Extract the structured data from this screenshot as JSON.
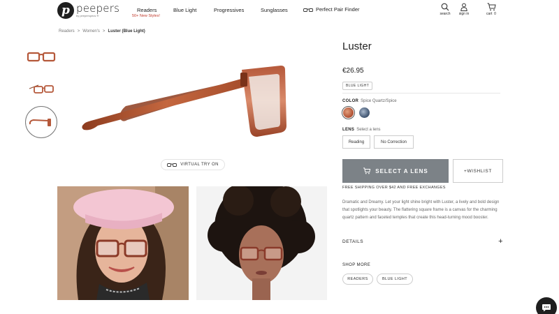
{
  "header": {
    "logo_letter": "p",
    "logo_name": "peepers",
    "logo_sub": "by peeperspecs ®",
    "nav": [
      {
        "label": "Readers",
        "sub": "50+ New Styles!"
      },
      {
        "label": "Blue Light"
      },
      {
        "label": "Progressives"
      },
      {
        "label": "Sunglasses"
      },
      {
        "label": "Perfect Pair Finder",
        "icon": "glasses-icon"
      }
    ],
    "utilities": [
      {
        "label": "search",
        "icon": "search-icon"
      },
      {
        "label": "sign in",
        "icon": "user-icon"
      },
      {
        "label": "cart",
        "icon": "cart-icon",
        "count": "0"
      }
    ]
  },
  "breadcrumb": [
    "Readers",
    "Women's",
    "Luster (Blue Light)"
  ],
  "gallery": {
    "virtual_try_on": "VIRTUAL TRY ON"
  },
  "product": {
    "title": "Luster",
    "price": "€26.95",
    "tag": "BLUE LIGHT",
    "color_label": "COLOR",
    "color_value": "Spice Quartz/Spice",
    "swatches": [
      {
        "name": "Spice Quartz/Spice",
        "color": "#b5583a",
        "selected": true
      },
      {
        "name": "blue",
        "color": "#4a5f7a",
        "selected": false
      }
    ],
    "lens_label": "LENS",
    "lens_value": "Select a lens",
    "lens_options": [
      "Reading",
      "No Correction"
    ],
    "select_lens_button": "SELECT A LENS",
    "wishlist_button": "+WISHLIST",
    "shipping_note": "FREE SHIPPING OVER $42 AND FREE EXCHANGES",
    "description": "Dramatic and Dreamy. Let your light shine bright with Luster, a lively and bold design that spotlights your beauty. The flattering square frame is a canvas for the charming quartz pattern and faceted temples that create this head-turning mood booster.",
    "details_label": "DETAILS",
    "shop_more_label": "SHOP MORE",
    "shop_more": [
      "READERS",
      "BLUE LIGHT"
    ]
  },
  "colors": {
    "frame": "#b5583a",
    "button": "#7c8287",
    "accent_red": "#c0392b"
  }
}
